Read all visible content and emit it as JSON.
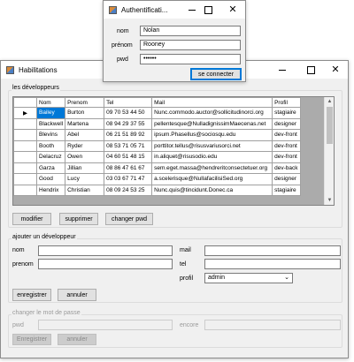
{
  "main_window": {
    "title": "Habilitations",
    "developers_group": {
      "title": "les développeurs",
      "columns": [
        "Nom",
        "Prenom",
        "Tel",
        "Mail",
        "Profil"
      ],
      "rows": [
        {
          "nom": "Bailey",
          "prenom": "Burton",
          "tel": "09 70 53 44 50",
          "mail": "Nunc.commodo.auctor@sollicitudinorci.org",
          "profil": "stagiaire"
        },
        {
          "nom": "Blackwell",
          "prenom": "Martena",
          "tel": "08 94 29 37 55",
          "mail": "pellentesque@NulladignissimMaecenas.net",
          "profil": "designer"
        },
        {
          "nom": "Blevins",
          "prenom": "Abel",
          "tel": "06 21 51 89 92",
          "mail": "ipsum.Phasellus@sociosqu.edu",
          "profil": "dev-front"
        },
        {
          "nom": "Booth",
          "prenom": "Ryder",
          "tel": "08 53 71 05 71",
          "mail": "porttitor.tellus@risusvariusorci.net",
          "profil": "dev-front"
        },
        {
          "nom": "Delacruz",
          "prenom": "Owen",
          "tel": "04 60 51 48 15",
          "mail": "in.aliquet@risusodio.edu",
          "profil": "dev-front"
        },
        {
          "nom": "Garza",
          "prenom": "Jillian",
          "tel": "08 86 47 61 67",
          "mail": "sem.eget.massa@hendreritconsectetuer.org",
          "profil": "dev-back"
        },
        {
          "nom": "Good",
          "prenom": "Lucy",
          "tel": "03 03 67 71 47",
          "mail": "a.scelerisque@NullafacilisiSed.org",
          "profil": "designer"
        },
        {
          "nom": "Hendrix",
          "prenom": "Christian",
          "tel": "08 09 24 53 25",
          "mail": "Nunc.quis@tincidunt.Donec.ca",
          "profil": "stagiaire"
        }
      ],
      "buttons": {
        "modifier": "modifier",
        "supprimer": "supprimer",
        "changer_pwd": "changer pwd"
      }
    },
    "add_group": {
      "title": "ajouter un développeur",
      "nom_label": "nom",
      "prenom_label": "prenom",
      "mail_label": "mail",
      "tel_label": "tel",
      "profil_label": "profil",
      "profil_value": "admin",
      "nom_value": "",
      "prenom_value": "",
      "mail_value": "",
      "tel_value": "",
      "enregistrer": "enregistrer",
      "annuler": "annuler"
    },
    "pwd_group": {
      "title": "changer le mot de passe",
      "pwd_label": "pwd",
      "encore_label": "encore",
      "enregistrer": "Enregistrer",
      "annuler": "annuler"
    }
  },
  "auth_window": {
    "title": "Authentificati...",
    "nom_label": "nom",
    "nom_value": "Nolan",
    "prenom_label": "prénom",
    "prenom_value": "Rooney",
    "pwd_label": "pwd",
    "pwd_value": "••••••",
    "connect_button": "se connecter"
  },
  "icons": {
    "selected_row_marker": "row-selector-icon",
    "dropdown": "chevron-down-icon"
  }
}
